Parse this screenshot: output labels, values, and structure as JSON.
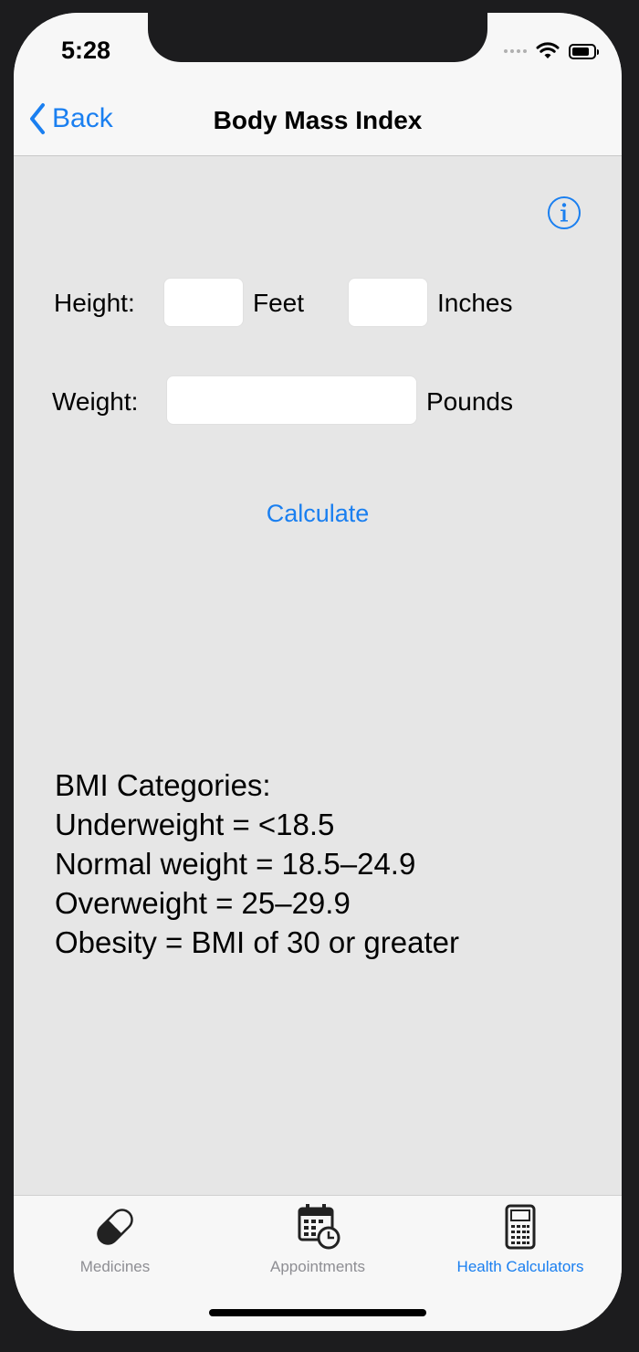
{
  "status": {
    "time": "5:28"
  },
  "nav": {
    "back_label": "Back",
    "title": "Body Mass Index"
  },
  "form": {
    "height_label": "Height:",
    "feet_unit": "Feet",
    "inches_unit": "Inches",
    "weight_label": "Weight:",
    "pounds_unit": "Pounds",
    "feet_value": "",
    "inches_value": "",
    "weight_value": "",
    "calculate_label": "Calculate"
  },
  "categories": [
    "BMI Categories:",
    "Underweight = <18.5",
    "Normal weight = 18.5–24.9",
    "Overweight = 25–29.9",
    "Obesity = BMI of 30 or greater"
  ],
  "tabs": [
    {
      "label": "Medicines",
      "icon": "pill-icon",
      "active": false
    },
    {
      "label": "Appointments",
      "icon": "calendar-clock-icon",
      "active": false
    },
    {
      "label": "Health Calculators",
      "icon": "calculator-icon",
      "active": true
    }
  ],
  "colors": {
    "accent": "#1a7ff0",
    "background": "#e6e6e6",
    "bar": "#f7f7f7"
  }
}
